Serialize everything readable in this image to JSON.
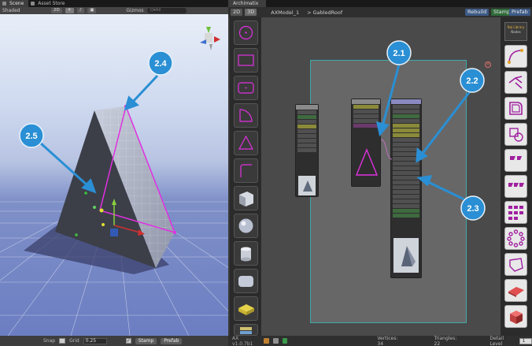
{
  "scene_panel": {
    "tabs": [
      "Scene",
      "Asset Store"
    ],
    "toolbar": {
      "shading": "Shaded",
      "mode_2d": "2D",
      "gizmos": "Gizmos",
      "search": "Q▾All"
    },
    "bottom_bar": {
      "snap_label": "Snap",
      "grid_label": "Grid",
      "grid_value": "0.25",
      "stamp": "Stamp",
      "prefab": "Prefab"
    }
  },
  "archimatix_panel": {
    "tab": "Archimatix",
    "modes": [
      "2D",
      "3D"
    ],
    "breadcrumb_model": "AXModel_1",
    "breadcrumb_node": "> GabledRoof",
    "actions": {
      "rebuild": "Rebuild",
      "stamp": "Stamp",
      "prefab": "Prefab"
    },
    "right_rail_header": [
      "Naj Library",
      "Nodes"
    ],
    "status": {
      "version": "AX v1.0.7b1",
      "vertices": "Vertices: 34",
      "triangles": "Triangles: 22",
      "detail_label": "Detail Level",
      "detail_value": "1"
    }
  },
  "callouts": [
    "2.1",
    "2.2",
    "2.3",
    "2.4",
    "2.5"
  ],
  "colors": {
    "callout": "#2a8fd4",
    "magenta": "#e030e0",
    "teal_frame": "#3fa8a8",
    "sky_top": "#e8eef8",
    "ground": "#6c7ec2"
  }
}
